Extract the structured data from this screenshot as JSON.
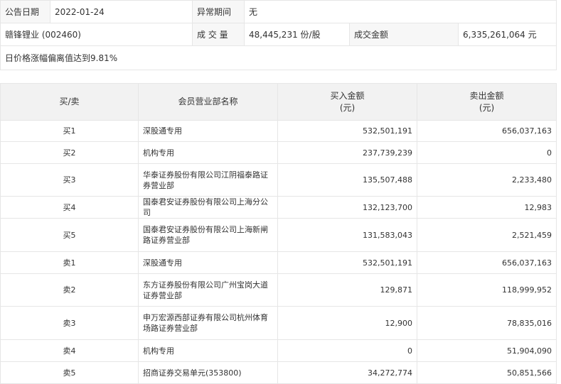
{
  "info": {
    "announce_date_label": "公告日期",
    "announce_date": "2022-01-24",
    "abnormal_period_label": "异常期间",
    "abnormal_period": "无",
    "stock": "赣锋锂业 (002460)",
    "volume_label": "成 交 量",
    "volume": "48,445,231 份/股",
    "amount_label": "成交金额",
    "amount": "6,335,261,064 元",
    "reason": "日价格涨幅偏离值达到9.81%"
  },
  "table": {
    "headers": {
      "side": "买/卖",
      "dept": "会员营业部名称",
      "buy": "买入金额",
      "buy_unit": "(元)",
      "sell": "卖出金额",
      "sell_unit": "(元)"
    },
    "rows": [
      {
        "side": "买1",
        "dept": "深股通专用",
        "buy": "532,501,191",
        "sell": "656,037,163"
      },
      {
        "side": "买2",
        "dept": "机构专用",
        "buy": "237,739,239",
        "sell": "0"
      },
      {
        "side": "买3",
        "dept": "华泰证券股份有限公司江阴福泰路证券营业部",
        "buy": "135,507,488",
        "sell": "2,233,480"
      },
      {
        "side": "买4",
        "dept": "国泰君安证券股份有限公司上海分公司",
        "buy": "132,123,700",
        "sell": "12,983"
      },
      {
        "side": "买5",
        "dept": "国泰君安证券股份有限公司上海新闸路证券营业部",
        "buy": "131,583,043",
        "sell": "2,521,459"
      },
      {
        "side": "卖1",
        "dept": "深股通专用",
        "buy": "532,501,191",
        "sell": "656,037,163"
      },
      {
        "side": "卖2",
        "dept": "东方证券股份有限公司广州宝岗大道证券营业部",
        "buy": "129,871",
        "sell": "118,999,952"
      },
      {
        "side": "卖3",
        "dept": "申万宏源西部证券有限公司杭州体育场路证券营业部",
        "buy": "12,900",
        "sell": "78,835,016"
      },
      {
        "side": "卖4",
        "dept": "机构专用",
        "buy": "0",
        "sell": "51,904,090"
      },
      {
        "side": "卖5",
        "dept": "招商证券交易单元(353800)",
        "buy": "34,272,774",
        "sell": "50,851,566"
      }
    ]
  }
}
